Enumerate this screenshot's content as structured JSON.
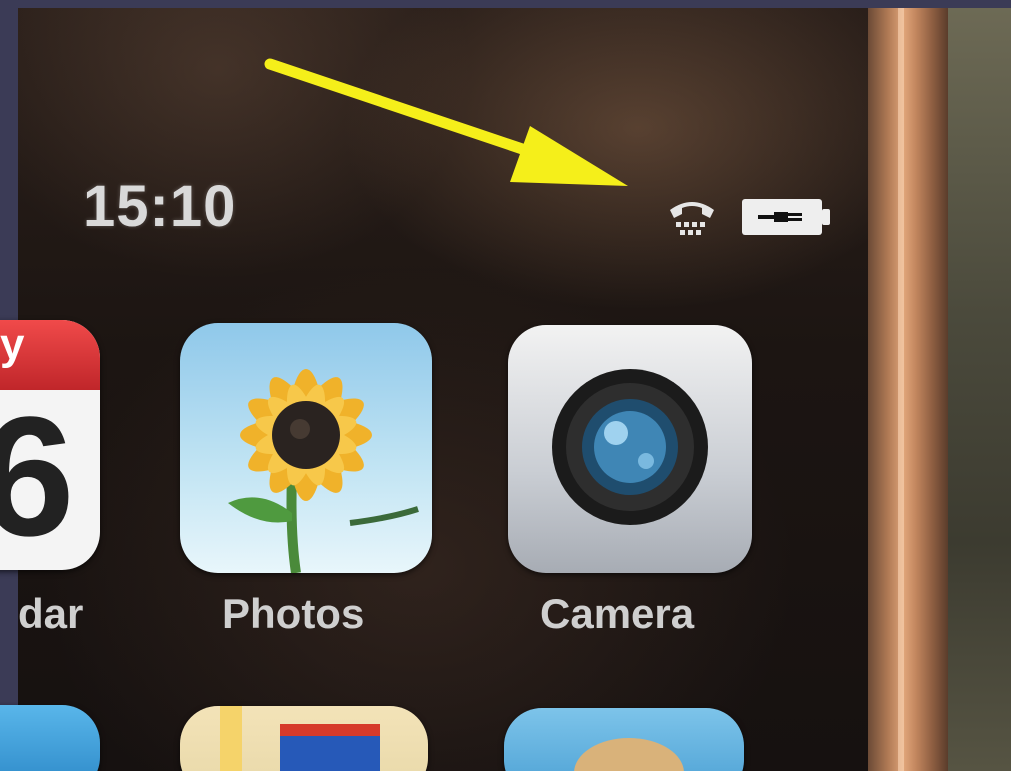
{
  "status_bar": {
    "time": "15:10",
    "icons": [
      "tty-icon",
      "battery-charging-icon"
    ]
  },
  "annotation": {
    "arrow_color": "#f5ef1a",
    "arrow_points_to": "tty-icon"
  },
  "apps": [
    {
      "name": "calendar",
      "label": "dar",
      "day": "y",
      "date": "6",
      "icon": "calendar-icon"
    },
    {
      "name": "photos",
      "label": "Photos",
      "icon": "sunflower-icon"
    },
    {
      "name": "camera",
      "label": "Camera",
      "icon": "camera-lens-icon"
    }
  ],
  "colors": {
    "label_text": "#cfcfcf",
    "calendar_header": "#e03a3a"
  }
}
